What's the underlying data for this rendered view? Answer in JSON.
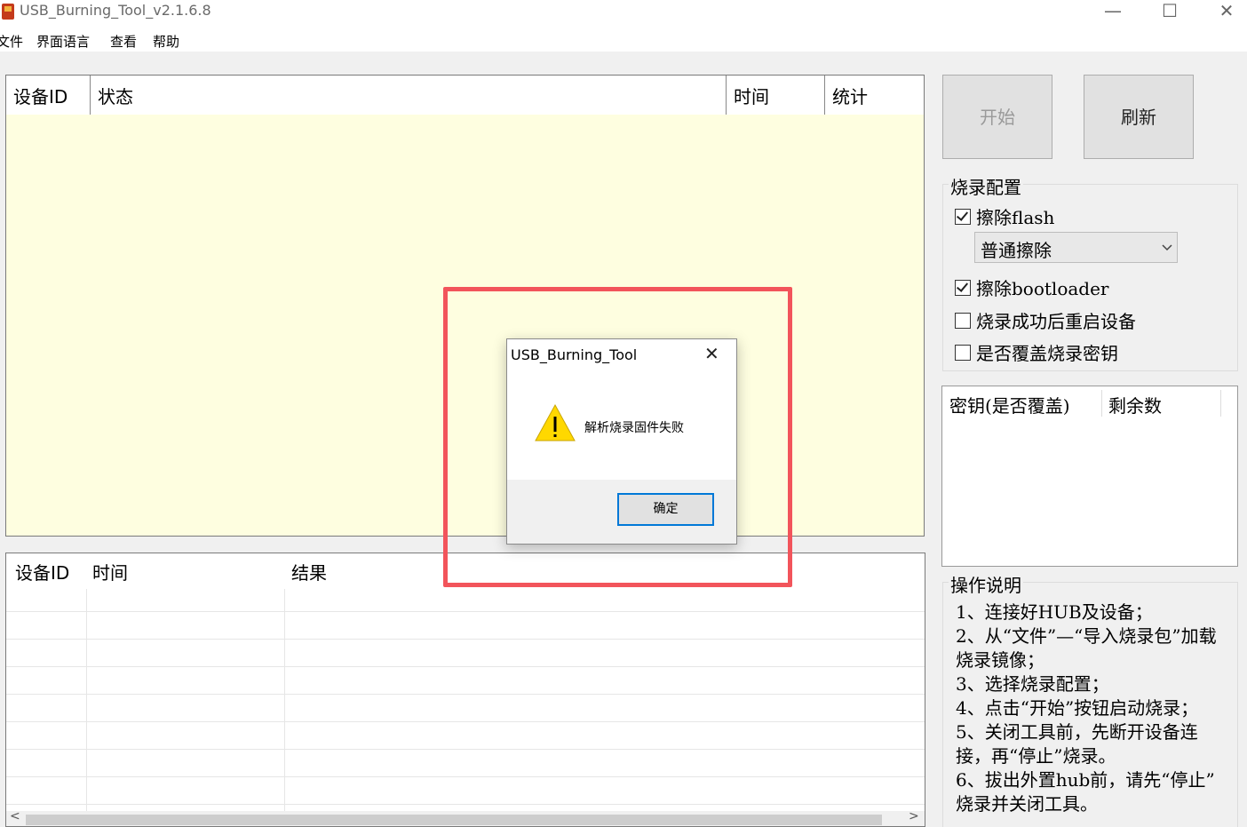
{
  "window": {
    "title": "USB_Burning_Tool_v2.1.6.8",
    "minimize": "—",
    "maximize": "☐",
    "close": "✕"
  },
  "menu": [
    "文件",
    "界面语言",
    "查看",
    "帮助"
  ],
  "device_table": {
    "columns": [
      "设备ID",
      "状态",
      "时间",
      "统计"
    ]
  },
  "result_table": {
    "columns": [
      "设备ID",
      "时间",
      "结果"
    ]
  },
  "buttons": {
    "start": "开始",
    "refresh": "刷新"
  },
  "burn_config": {
    "title": "烧录配置",
    "erase_flash": {
      "label": "擦除flash",
      "checked": true
    },
    "erase_mode": "普通擦除",
    "erase_bootloader": {
      "label": "擦除bootloader",
      "checked": true
    },
    "reboot_after": {
      "label": "烧录成功后重启设备",
      "checked": false
    },
    "overwrite_key": {
      "label": "是否覆盖烧录密钥",
      "checked": false
    }
  },
  "key_table": {
    "columns": [
      "密钥(是否覆盖)",
      "剩余数"
    ]
  },
  "instructions": {
    "title": "操作说明",
    "lines": [
      "1、连接好HUB及设备；",
      "2、从“文件”—“导入烧录包”加载",
      "烧录镜像；",
      "3、选择烧录配置；",
      "4、点击“开始”按钮启动烧录；",
      "5、关闭工具前，先断开设备连",
      "接，再“停止”烧录。",
      "6、拔出外置hub前，请先“停止”",
      "烧录并关闭工具。"
    ]
  },
  "dialog": {
    "title": "USB_Burning_Tool",
    "message": "解析烧录固件失败",
    "ok": "确定",
    "close": "✕"
  },
  "scroll": {
    "left": "<",
    "right": ">"
  }
}
